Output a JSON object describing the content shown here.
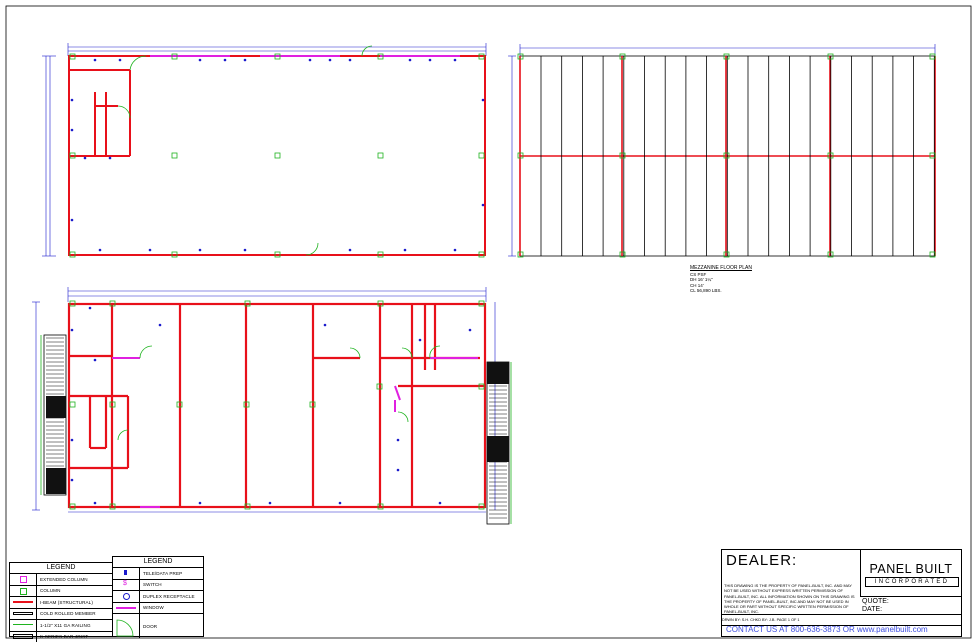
{
  "mezzanine_label": {
    "title": "MEZZANINE FLOOR PLAN",
    "lines": [
      "CS PSF",
      "DH 16' 1¼\"",
      "CH 14'",
      "CL 56,890 LBS."
    ]
  },
  "legend_left": {
    "title": "LEGEND",
    "items": [
      {
        "symbol": "extended-column",
        "label": "EXTENDED COLUMN"
      },
      {
        "symbol": "column",
        "label": "COLUMN"
      },
      {
        "symbol": "i-beam",
        "label": "I-BEAM (STRUCTURAL)"
      },
      {
        "symbol": "cold-rolled",
        "label": "COLD ROLLED MEMBER"
      },
      {
        "symbol": "railing",
        "label": "1-1/2\" X11 GA RAILING"
      },
      {
        "symbol": "bar-joist",
        "label": "K-SERIES BAR JOIST"
      }
    ]
  },
  "legend_right": {
    "title": "LEGEND",
    "items": [
      {
        "symbol": "tele-data",
        "label": "TELE/DATA PREP"
      },
      {
        "symbol": "switch",
        "label": "SWITCH"
      },
      {
        "symbol": "duplex",
        "label": "DUPLEX RECEPTACLE"
      },
      {
        "symbol": "window",
        "label": "WINDOW"
      },
      {
        "symbol": "door",
        "label": "DOOR"
      }
    ]
  },
  "title_block": {
    "dealer": "DEALER:",
    "disclaimer": "THIS DRAWING IS THE PROPERTY OF PANEL-BUILT, INC. AND MAY NOT BE USED WITHOUT EXPRESS WRITTEN PERMISSION OF PANEL-BUILT, INC. ALL INFORMATION SHOWN ON THIS DRAWING IS THE PROPERTY OF PANEL-BUILT, INC AND MAY NOT BE USED IN WHOLE OR PART WITHOUT SPECIFIC WRITTEN PERMISSION OF PANEL-BUILT, INC.",
    "brand_name": "PANEL BUILT",
    "brand_sub": "INCORPORATED",
    "quote": "QUOTE:",
    "date": "DATE:",
    "small_row": "DRWN BY: S.H.     CHKD BY: J.B.     PAGE 1 OF 1",
    "contact": "CONTACT US AT  800-636-3873   OR    www.panelbuilt.com"
  },
  "colors": {
    "wall": "#e8101a",
    "column": "#1fb31f",
    "dimension": "#1a1acc",
    "window": "#e020e0",
    "outlet": "#1a1acc"
  }
}
